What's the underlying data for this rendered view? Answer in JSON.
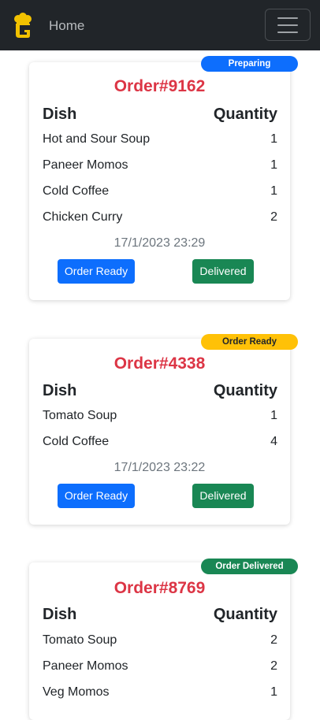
{
  "nav": {
    "home_label": "Home",
    "brand_icon": "chef-hat-logo",
    "menu_icon": "hamburger-menu-icon"
  },
  "colors": {
    "navbar_bg": "#212529",
    "order_title": "#dc3545",
    "preparing": "#0d6efd",
    "order_ready": "#ffc107",
    "delivered": "#198754"
  },
  "orders": [
    {
      "status": "Preparing",
      "title": "Order#9162",
      "dish_header": "Dish",
      "qty_header": "Quantity",
      "items": [
        {
          "name": "Hot and Sour Soup",
          "qty": "1"
        },
        {
          "name": "Paneer Momos",
          "qty": "1"
        },
        {
          "name": "Cold Coffee",
          "qty": "1"
        },
        {
          "name": "Chicken Curry",
          "qty": "2"
        }
      ],
      "timestamp": "17/1/2023 23:29",
      "ready_button": "Order Ready",
      "delivered_button": "Delivered"
    },
    {
      "status": "Order Ready",
      "title": "Order#4338",
      "dish_header": "Dish",
      "qty_header": "Quantity",
      "items": [
        {
          "name": "Tomato Soup",
          "qty": "1"
        },
        {
          "name": "Cold Coffee",
          "qty": "4"
        }
      ],
      "timestamp": "17/1/2023 23:22",
      "ready_button": "Order Ready",
      "delivered_button": "Delivered"
    },
    {
      "status": "Order Delivered",
      "title": "Order#8769",
      "dish_header": "Dish",
      "qty_header": "Quantity",
      "items": [
        {
          "name": "Tomato Soup",
          "qty": "2"
        },
        {
          "name": "Paneer Momos",
          "qty": "2"
        },
        {
          "name": "Veg Momos",
          "qty": "1"
        }
      ]
    }
  ]
}
